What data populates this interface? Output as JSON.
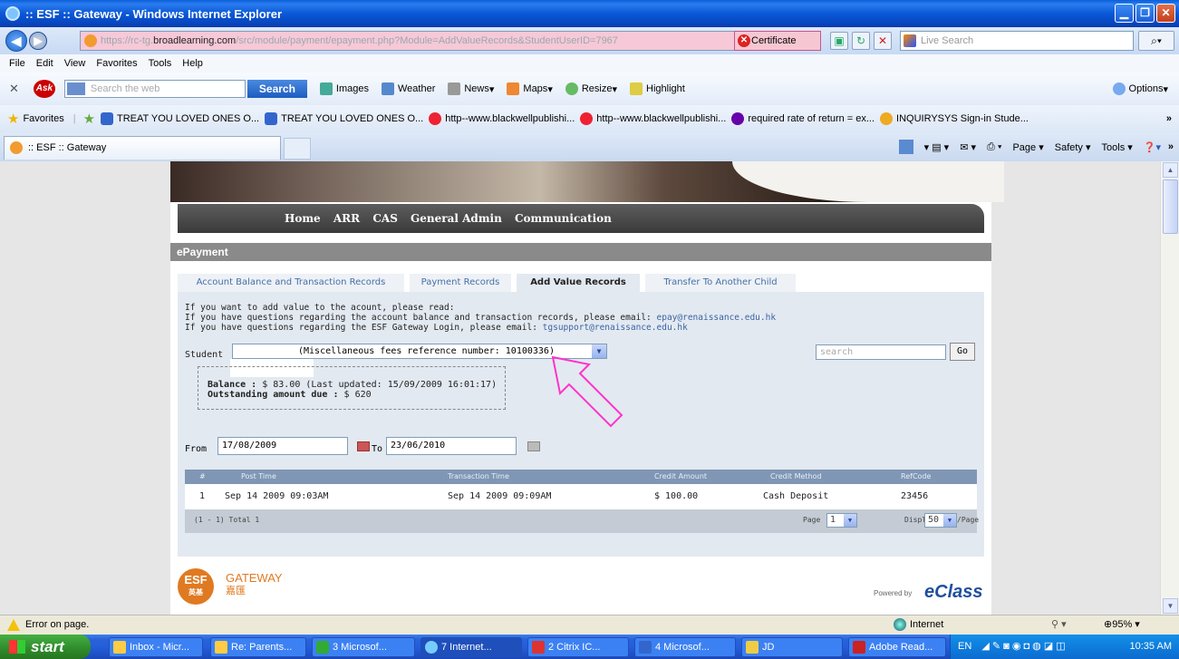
{
  "window": {
    "title": ":: ESF :: Gateway - Windows Internet Explorer"
  },
  "address_bar": {
    "url_prefix": "https://rc-tg.",
    "url_host": "broadlearning.com",
    "url_suffix": "/src/module/payment/epayment.php?Module=AddValueRecords&StudentUserID=7967",
    "cert_error": "Certificate Error",
    "live_search_placeholder": "Live Search"
  },
  "menu": [
    "File",
    "Edit",
    "View",
    "Favorites",
    "Tools",
    "Help"
  ],
  "ask_toolbar": {
    "search_placeholder": "Search the web",
    "search_button": "Search",
    "tools": [
      "Images",
      "Weather",
      "News",
      "Maps",
      "Resize",
      "Highlight"
    ],
    "options": "Options"
  },
  "favorites": {
    "label": "Favorites",
    "items": [
      "TREAT YOU LOVED ONES O...",
      "TREAT YOU LOVED ONES O...",
      "http--www.blackwellpublishi...",
      "http--www.blackwellpublishi...",
      "required rate of return = ex...",
      "INQUIRYSYS Sign-in Stude..."
    ]
  },
  "tab": {
    "title": ":: ESF :: Gateway"
  },
  "command_bar": [
    "Page",
    "Safety",
    "Tools"
  ],
  "site_nav": [
    "Home",
    "ARR",
    "CAS",
    "General Admin",
    "Communication"
  ],
  "section_title": "ePayment",
  "tabs": [
    {
      "label": "Account Balance and Transaction Records",
      "active": false
    },
    {
      "label": "Payment Records",
      "active": false
    },
    {
      "label": "Add Value Records",
      "active": true
    },
    {
      "label": "Transfer To Another Child",
      "active": false
    }
  ],
  "info": {
    "line1": "If you want to add value to the acount, please read:",
    "line2_prefix": "If you have questions regarding the account balance and transaction records, please email:",
    "line2_email": "epay@renaissance.edu.hk",
    "line3_prefix": "If you have questions regarding the ESF Gateway Login, please email:",
    "line3_email": "tgsupport@renaissance.edu.hk"
  },
  "student": {
    "label": "Student",
    "selected": "(Miscellaneous fees reference number: 10100336)"
  },
  "search": {
    "placeholder": "search",
    "button": "Go"
  },
  "balance": {
    "balance_label": "Balance :",
    "balance_value": "$ 83.00 (Last updated: 15/09/2009 16:01:17)",
    "outstanding_label": "Outstanding amount due :",
    "outstanding_value": "$ 620"
  },
  "date_range": {
    "from_label": "From",
    "from_value": "17/08/2009",
    "to_label": "To",
    "to_value": "23/06/2010"
  },
  "table": {
    "columns": [
      "#",
      "Post Time",
      "Transaction Time",
      "Credit Amount",
      "Credit Method",
      "RefCode"
    ],
    "rows": [
      [
        "1",
        "Sep 14 2009 09:03AM",
        "Sep 14 2009 09:09AM",
        "$ 100.00",
        "Cash Deposit",
        "23456"
      ]
    ],
    "total_text": "(1 - 1) Total 1",
    "page_label": "Page",
    "page_value": "1",
    "display_label": "Display",
    "display_value": "50",
    "per_page_label": "/Page"
  },
  "footer": {
    "logo_text": "ESF",
    "logo_zh": "英基",
    "gateway": "GATEWAY",
    "gateway_zh": "嘉匯",
    "powered_by": "Powered by",
    "brand": "eClass"
  },
  "status_bar": {
    "message": "Error on page.",
    "zone": "Internet",
    "zoom": "95%"
  },
  "taskbar": {
    "start": "start",
    "tasks": [
      {
        "label": "Inbox - Micr...",
        "active": false
      },
      {
        "label": "Re: Parents...",
        "active": false
      },
      {
        "label": "3 Microsof...",
        "active": false
      },
      {
        "label": "7 Internet...",
        "active": true
      },
      {
        "label": "2 Citrix IC...",
        "active": false
      },
      {
        "label": "4 Microsof...",
        "active": false
      },
      {
        "label": "JD",
        "active": false
      },
      {
        "label": "Adobe Read...",
        "active": false
      }
    ],
    "lang": "EN",
    "clock": "10:35 AM"
  },
  "colors": {
    "title_bar": "#0a58d6",
    "nav_strip": "#4a4a4a",
    "panel_bg": "#e3e9f1",
    "link": "#3b64a0",
    "annotation_arrow": "#ff33cc",
    "esf_orange": "#e07a22"
  }
}
